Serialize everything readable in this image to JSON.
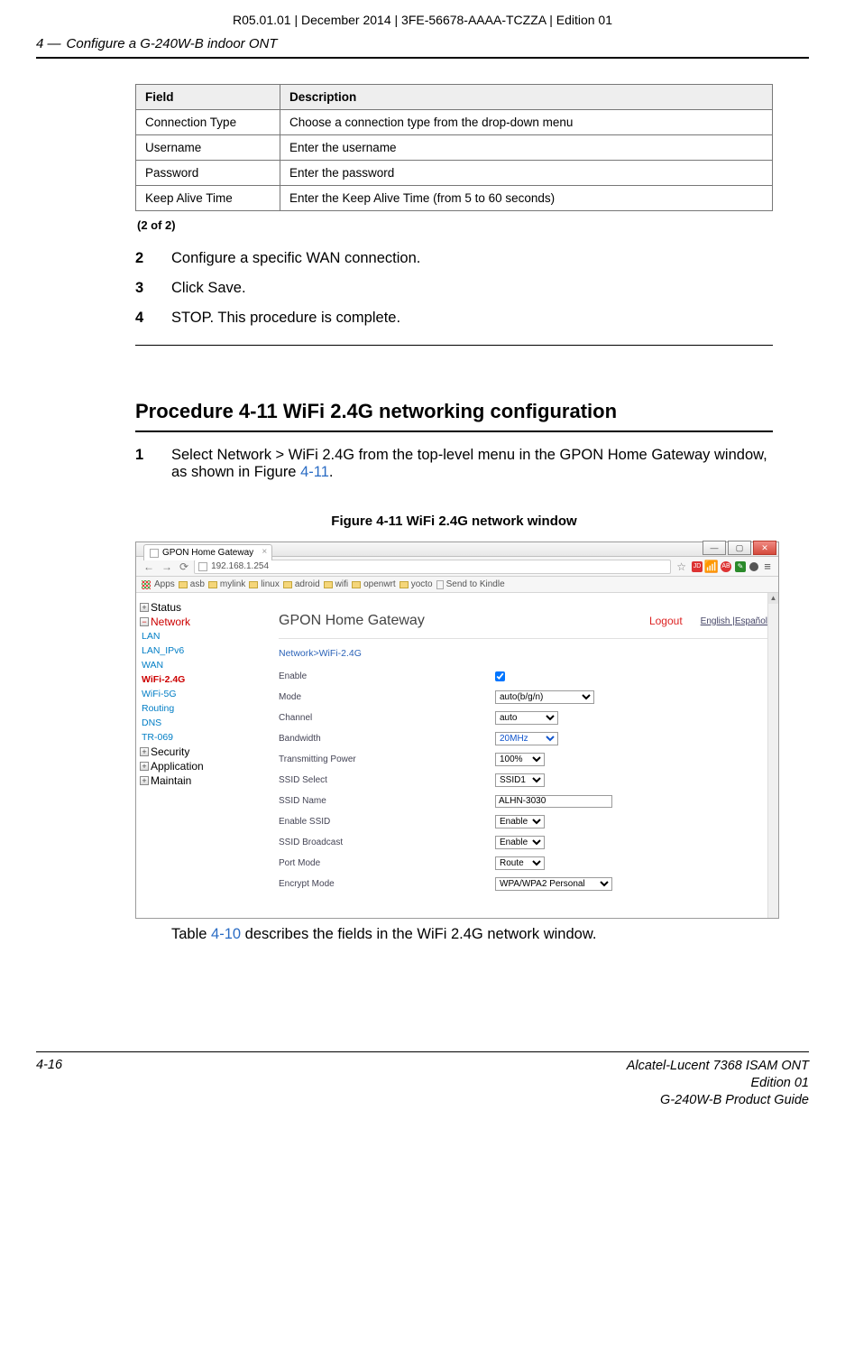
{
  "meta": {
    "line": "R05.01.01 | December 2014 | 3FE-56678-AAAA-TCZZA | Edition 01"
  },
  "header": {
    "chapnum": "4 —",
    "title": "Configure a G-240W-B indoor ONT"
  },
  "table": {
    "h0": "Field",
    "h1": "Description",
    "rows": [
      {
        "f": "Connection Type",
        "d": "Choose a connection type from the drop-down menu"
      },
      {
        "f": "Username",
        "d": "Enter the username"
      },
      {
        "f": "Password",
        "d": "Enter the password"
      },
      {
        "f": "Keep Alive Time",
        "d": "Enter the Keep Alive Time (from 5 to 60 seconds)"
      }
    ],
    "foot": "(2 of 2)"
  },
  "steps_a": [
    {
      "n": "2",
      "t": "Configure a specific WAN connection."
    },
    {
      "n": "3",
      "t": "Click Save."
    },
    {
      "n": "4",
      "t": "STOP. This procedure is complete."
    }
  ],
  "proc_title": "Procedure 4-11  WiFi 2.4G networking configuration",
  "step1": {
    "n": "1",
    "t1": "Select Network > WiFi 2.4G from the top-level menu in the GPON Home Gateway window, as shown in Figure ",
    "link": "4-11",
    "t2": "."
  },
  "fig_cap": "Figure 4-11  WiFi 2.4G network window",
  "browser": {
    "tab_title": "GPON Home Gateway",
    "url": "192.168.1.254",
    "apps_label": "Apps",
    "bookmarks": [
      "asb",
      "mylink",
      "linux",
      "adroid",
      "wifi",
      "openwrt",
      "yocto"
    ],
    "bookmark_page": "Send to Kindle"
  },
  "app": {
    "brand": "GPON Home Gateway",
    "logout": "Logout",
    "lang1": "English",
    "lang_sep": " |",
    "lang2": "Español",
    "crumb": "Network>WiFi-2.4G",
    "sidebar_top": [
      {
        "label": "Status",
        "cls": ""
      },
      {
        "label": "Network",
        "cls": "red"
      }
    ],
    "sidebar_items": [
      "LAN",
      "LAN_IPv6",
      "WAN",
      "WiFi-2.4G",
      "WiFi-5G",
      "Routing",
      "DNS",
      "TR-069"
    ],
    "sidebar_active": "WiFi-2.4G",
    "sidebar_bottom": [
      "Security",
      "Application",
      "Maintain"
    ],
    "form": {
      "enable_lbl": "Enable",
      "mode_lbl": "Mode",
      "mode_val": "auto(b/g/n)",
      "channel_lbl": "Channel",
      "channel_val": "auto",
      "bw_lbl": "Bandwidth",
      "bw_val": "20MHz",
      "tx_lbl": "Transmitting Power",
      "tx_val": "100%",
      "ssid_sel_lbl": "SSID Select",
      "ssid_sel_val": "SSID1",
      "ssid_name_lbl": "SSID Name",
      "ssid_name_val": "ALHN-3030",
      "en_ssid_lbl": "Enable SSID",
      "en_ssid_val": "Enable",
      "bcast_lbl": "SSID Broadcast",
      "bcast_val": "Enable",
      "port_lbl": "Port Mode",
      "port_val": "Route",
      "enc_lbl": "Encrypt Mode",
      "enc_val": "WPA/WPA2 Personal"
    }
  },
  "post_fig": {
    "t1": "Table ",
    "link": "4-10",
    "t2": " describes the fields in the WiFi 2.4G network window."
  },
  "footer": {
    "page": "4-16",
    "r1": "Alcatel-Lucent 7368 ISAM ONT",
    "r2": "Edition 01",
    "r3": "G-240W-B Product Guide"
  }
}
